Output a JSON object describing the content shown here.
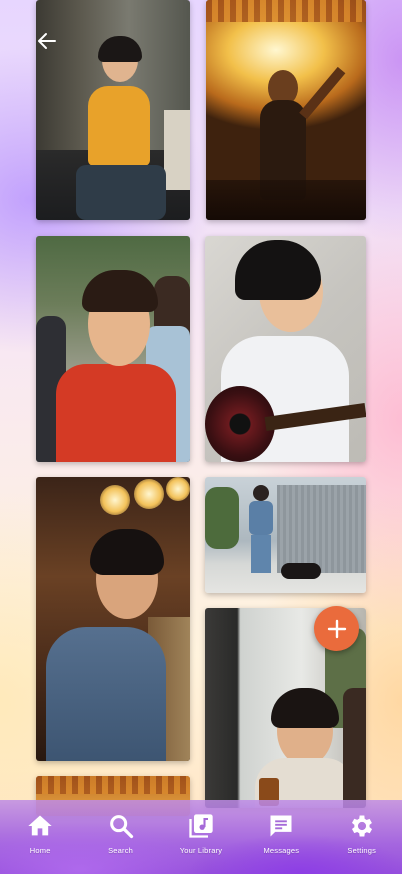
{
  "header": {
    "back_icon": "arrow-left-icon"
  },
  "gallery": {
    "photos": [
      {
        "name": "photo-woman-yellow-shirt-cafe",
        "column": "left"
      },
      {
        "name": "photo-concert-crowd-raised-arm",
        "column": "right"
      },
      {
        "name": "photo-woman-red-shirt-smiling",
        "column": "left"
      },
      {
        "name": "photo-woman-playing-guitar",
        "column": "right"
      },
      {
        "name": "photo-woman-bar-denim-jacket",
        "column": "left"
      },
      {
        "name": "photo-woman-walking-dog",
        "column": "right"
      },
      {
        "name": "photo-woman-cafe-window",
        "column": "right"
      },
      {
        "name": "photo-concert-partial",
        "column": "left"
      }
    ]
  },
  "fab": {
    "icon": "plus-icon",
    "color": "#ea6b3c"
  },
  "bottom_nav": {
    "items": [
      {
        "label": "Home",
        "icon": "home-icon"
      },
      {
        "label": "Search",
        "icon": "search-icon"
      },
      {
        "label": "Your Library",
        "icon": "library-icon"
      },
      {
        "label": "Messages",
        "icon": "message-icon"
      },
      {
        "label": "Settings",
        "icon": "gear-icon"
      }
    ]
  }
}
